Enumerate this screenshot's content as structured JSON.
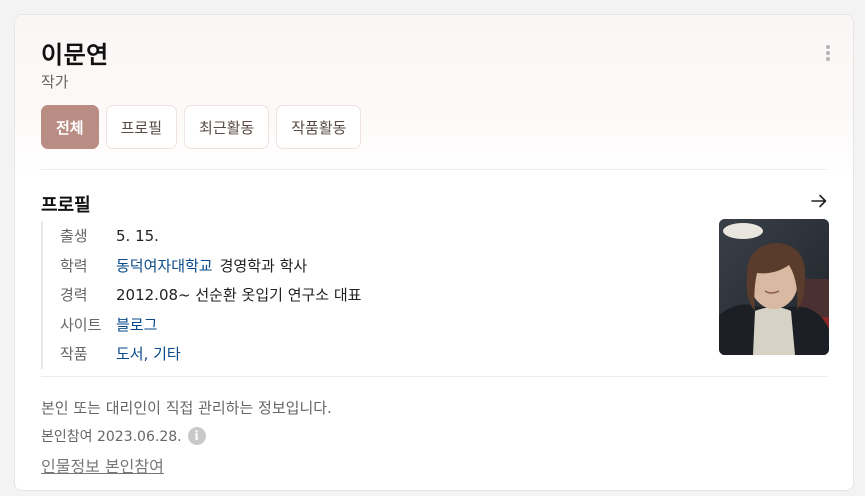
{
  "person": {
    "name": "이문연",
    "occupation": "작가"
  },
  "more_icon": "more-vertical-icon",
  "tabs": [
    {
      "label": "전체",
      "active": true
    },
    {
      "label": "프로필",
      "active": false
    },
    {
      "label": "최근활동",
      "active": false
    },
    {
      "label": "작품활동",
      "active": false
    }
  ],
  "profile": {
    "title": "프로필",
    "arrow_icon": "arrow-right-icon",
    "rows": [
      {
        "label": "출생",
        "value": "5. 15."
      },
      {
        "label": "학력",
        "link": "동덕여자대학교",
        "value": "경영학과 학사"
      },
      {
        "label": "경력",
        "value": "2012.08~ 선순환 옷입기 연구소 대표"
      },
      {
        "label": "사이트",
        "link": "블로그"
      },
      {
        "label": "작품",
        "link": "도서, 기타"
      }
    ]
  },
  "footer": {
    "note": "본인 또는 대리인이 직접 관리하는 정보입니다.",
    "participation_date": "본인참여 2023.06.28.",
    "info_icon": "info-icon",
    "participate_link": "인물정보 본인참여"
  },
  "colors": {
    "accent": "#b98d83",
    "link": "#0a4a8a"
  }
}
